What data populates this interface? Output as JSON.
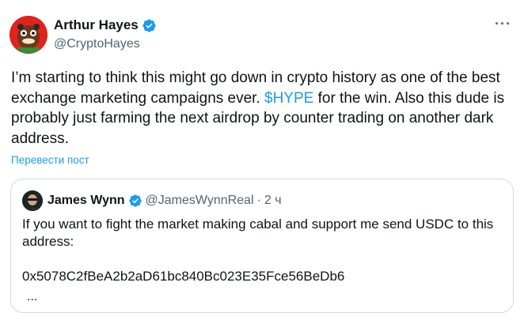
{
  "author": {
    "name": "Arthur Hayes",
    "handle": "@CryptoHayes",
    "verified": true,
    "avatar_icon": "red-face-avatar"
  },
  "more_menu": "···",
  "tweet": {
    "text_before": "I’m starting to think this might go down in crypto history as one of the best exchange marketing campaigns ever. ",
    "cashtag": "$HYPE",
    "text_after": " for the win. Also this dude is probably just farming the next airdrop by counter trading on another dark address."
  },
  "translate_label": "Перевести пост",
  "quote": {
    "name": "James Wynn",
    "handle": "@JamesWynnReal",
    "dot": "·",
    "time": "2 ч",
    "verified": true,
    "text": "If you want to fight the market making cabal and support me send USDC to this address:\n\n0x5078C2fBeA2b2aD61bc840Bc023E35Fce56BeDb6",
    "ellipsis": "..."
  },
  "colors": {
    "accent": "#1d9bf0",
    "text": "#0f1419",
    "secondary": "#536471",
    "border": "#cfd9de"
  }
}
